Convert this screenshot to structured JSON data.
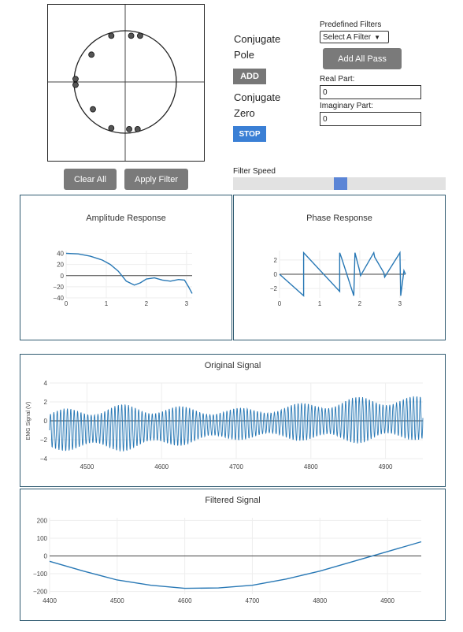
{
  "zplane": {
    "poles": [
      [
        -0.05,
        0.55
      ],
      [
        0.1,
        0.56
      ],
      [
        0.05,
        0.57
      ],
      [
        -0.48,
        0.34
      ],
      [
        -0.65,
        0.05
      ],
      [
        -0.65,
        -0.05
      ],
      [
        -0.45,
        -0.34
      ],
      [
        -0.05,
        -0.55
      ],
      [
        0.05,
        -0.56
      ],
      [
        0.17,
        -0.57
      ],
      [
        0.17,
        0.57
      ]
    ],
    "line_color": "#222222",
    "marker_color": "#555555"
  },
  "controls": {
    "conj_pole_label_1": "Conjugate",
    "conj_pole_label_2": "Pole",
    "add_label": "ADD",
    "conj_zero_label_1": "Conjugate",
    "conj_zero_label_2": "Zero",
    "stop_label": "STOP",
    "predefined_label": "Predefined Filters",
    "select_value": "Select A Filter",
    "add_all_pass_label": "Add All Pass",
    "real_part_label": "Real Part:",
    "real_part_value": "0",
    "imag_part_label": "Imaginary Part:",
    "imag_part_value": "0",
    "clear_all_label": "Clear All",
    "apply_filter_label": "Apply Filter",
    "filter_speed_label": "Filter Speed",
    "filter_speed_value": 0.27
  },
  "panels": {
    "amplitude_title": "Amplitude Response",
    "phase_title": "Phase Response",
    "original_title": "Original Signal",
    "filtered_title": "Filtered Signal"
  },
  "chart_data": [
    {
      "type": "line",
      "title": "Amplitude Response",
      "xlim": [
        0,
        3.14
      ],
      "ylim": [
        -40,
        45
      ],
      "xticks": [
        "0",
        "1",
        "2",
        "3"
      ],
      "yticks": [
        "40",
        "20",
        "0",
        "−20",
        "−40"
      ],
      "series": [
        {
          "x": [
            0,
            0.3,
            0.6,
            0.9,
            1.1,
            1.3,
            1.5,
            1.7,
            1.85,
            2.0,
            2.2,
            2.4,
            2.6,
            2.8,
            2.95,
            3.05,
            3.14
          ],
          "y": [
            40,
            39,
            35,
            28,
            20,
            8,
            -10,
            -17,
            -13,
            -6,
            -4,
            -8,
            -10,
            -7,
            -8,
            -20,
            -32
          ]
        }
      ]
    },
    {
      "type": "line",
      "title": "Phase Response",
      "xlim": [
        0,
        3.14
      ],
      "ylim": [
        -3.3,
        3.3
      ],
      "xticks": [
        "0",
        "1",
        "2",
        "3"
      ],
      "yticks": [
        "2",
        "0",
        "−2"
      ],
      "series": [
        {
          "x": [
            0,
            0.6,
            0.6,
            1.5,
            1.5,
            1.55,
            1.85,
            1.88,
            2.0,
            2.02,
            2.35,
            2.37,
            2.6,
            2.62,
            3.0,
            3.02,
            3.1,
            3.14
          ],
          "y": [
            0,
            -3,
            3,
            -2.4,
            3,
            2.2,
            -3,
            3,
            0.4,
            -0.2,
            3,
            2.4,
            0.2,
            -0.4,
            3,
            -3,
            0.5,
            0
          ]
        }
      ]
    },
    {
      "type": "line",
      "title": "Original Signal",
      "ylabel": "EMG Signal (V)",
      "xlim": [
        4450,
        4950
      ],
      "ylim": [
        -4,
        4
      ],
      "xticks": [
        "4500",
        "4600",
        "4700",
        "4800",
        "4900"
      ],
      "yticks": [
        "4",
        "2",
        "0",
        "−2",
        "−4"
      ],
      "series": [
        {
          "name": "",
          "values_description_offset": [
            -1,
            0.3
          ],
          "amplitude": [
            2.2,
            2.5
          ],
          "cycles": 110
        }
      ]
    },
    {
      "type": "line",
      "title": "Filtered Signal",
      "xlim": [
        4400,
        4950
      ],
      "ylim": [
        -215,
        215
      ],
      "xticks": [
        "4400",
        "4500",
        "4600",
        "4700",
        "4800",
        "4900"
      ],
      "yticks": [
        "200",
        "100",
        "0",
        "−100",
        "−200"
      ],
      "series": [
        {
          "x": [
            4400,
            4450,
            4500,
            4550,
            4600,
            4650,
            4700,
            4750,
            4800,
            4850,
            4900,
            4950
          ],
          "y": [
            -30,
            -85,
            -135,
            -165,
            -182,
            -180,
            -165,
            -130,
            -85,
            -30,
            25,
            80
          ]
        }
      ]
    }
  ],
  "colors": {
    "line": "#2878b5",
    "border": "#2f5a70",
    "button_blue": "#3a7fd5",
    "button_gray": "#777777"
  }
}
